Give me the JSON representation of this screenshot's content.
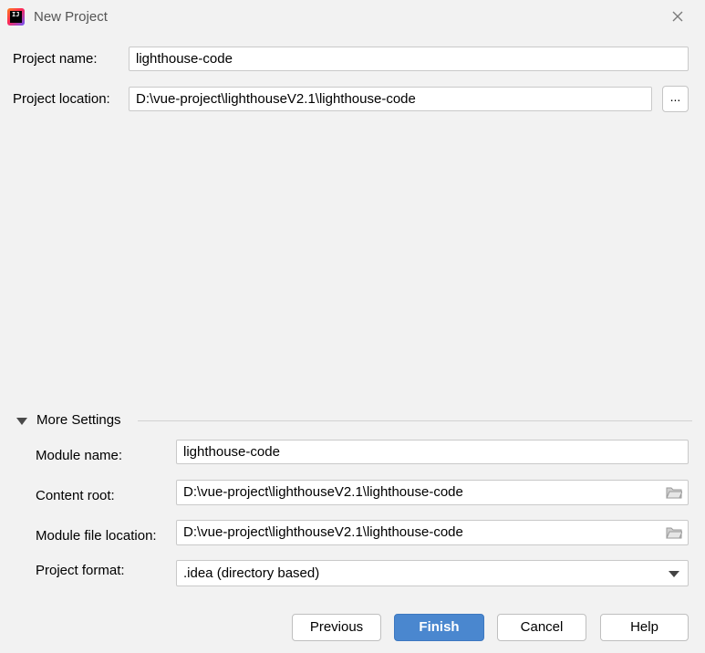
{
  "window": {
    "title": "New Project",
    "app_icon": "intellij-idea-icon",
    "close_icon": "close-icon"
  },
  "project": {
    "name_label": "Project name:",
    "name_value": "lighthouse-code",
    "location_label": "Project location:",
    "location_value": "D:\\vue-project\\lighthouseV2.1\\lighthouse-code",
    "browse_label": "..."
  },
  "more_settings": {
    "title": "More Settings",
    "expanded": true,
    "module_name_label": "Module name:",
    "module_name_value": "lighthouse-code",
    "content_root_label": "Content root:",
    "content_root_value": "D:\\vue-project\\lighthouseV2.1\\lighthouse-code",
    "module_file_label": "Module file location:",
    "module_file_value": "D:\\vue-project\\lighthouseV2.1\\lighthouse-code",
    "format_label": "Project format:",
    "format_value": ".idea (directory based)"
  },
  "buttons": {
    "previous": "Previous",
    "finish": "Finish",
    "cancel": "Cancel",
    "help": "Help"
  },
  "colors": {
    "background": "#f2f2f2",
    "primary_button": "#4a87cf"
  }
}
